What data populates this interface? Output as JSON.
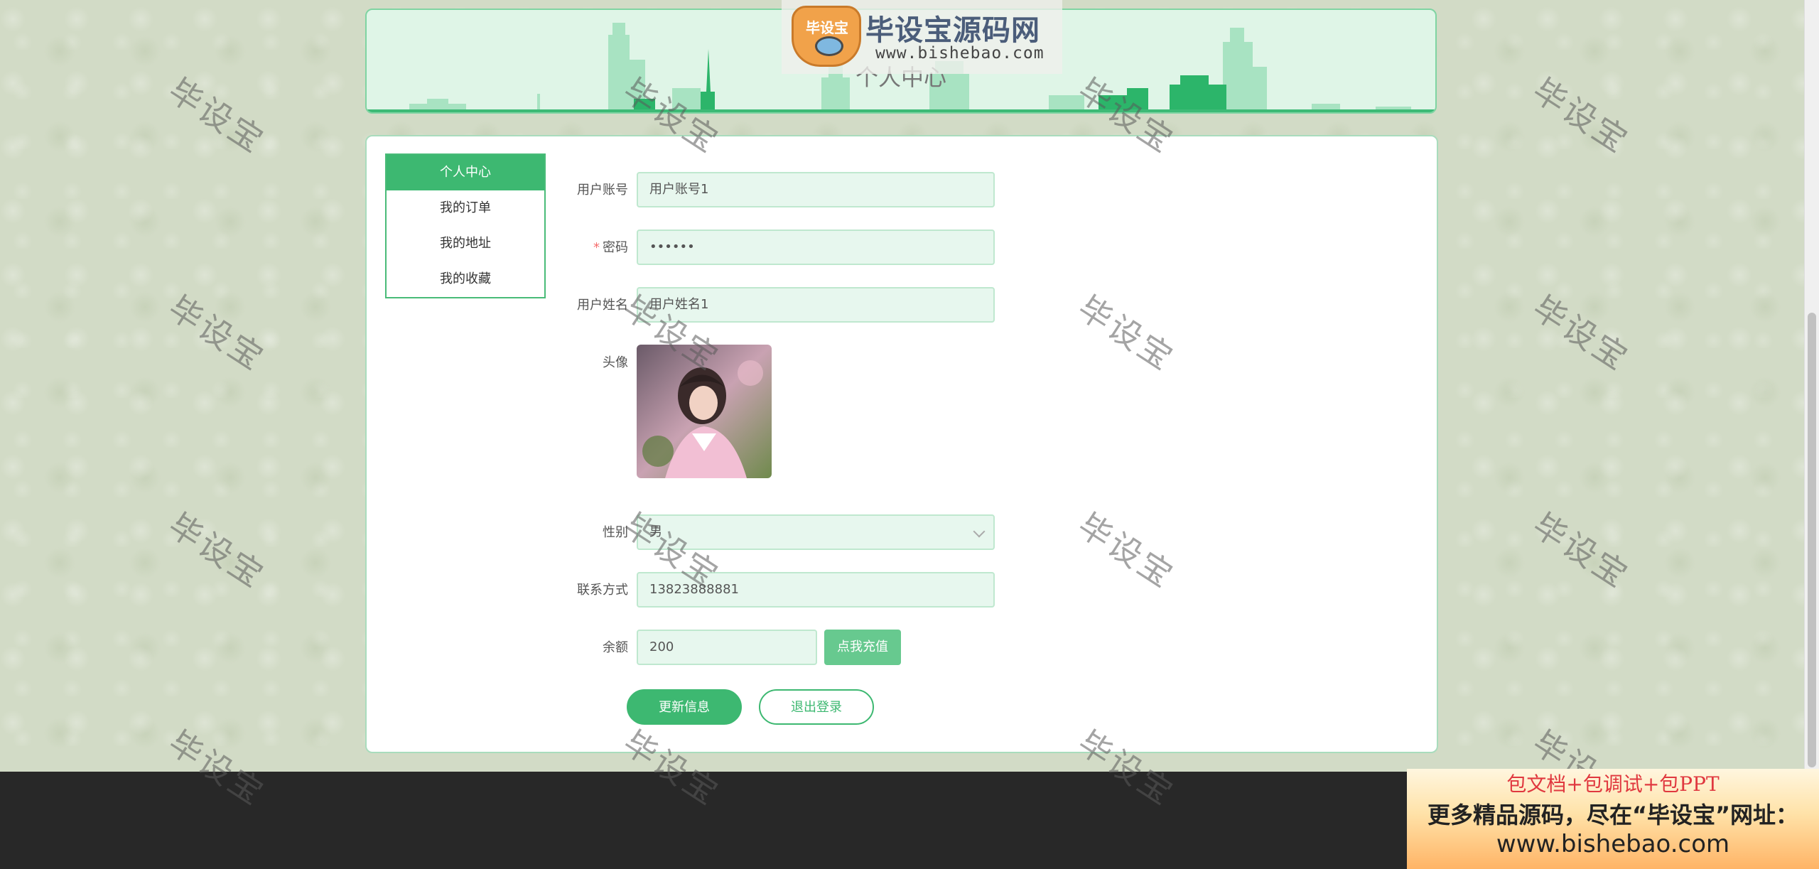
{
  "header": {
    "title": "个人中心",
    "logo_name": "毕设宝源码网",
    "logo_url": "www.bishebao.com",
    "logo_badge": "毕设宝"
  },
  "sidebar": {
    "items": [
      {
        "label": "个人中心",
        "active": true
      },
      {
        "label": "我的订单",
        "active": false
      },
      {
        "label": "我的地址",
        "active": false
      },
      {
        "label": "我的收藏",
        "active": false
      }
    ]
  },
  "form": {
    "username": {
      "label": "用户账号",
      "value": "用户账号1"
    },
    "password": {
      "label": "密码",
      "required_mark": "*",
      "value": "••••••"
    },
    "realname": {
      "label": "用户姓名",
      "value": "用户姓名1"
    },
    "avatar": {
      "label": "头像"
    },
    "gender": {
      "label": "性别",
      "value": "男"
    },
    "phone": {
      "label": "联系方式",
      "value": "13823888881"
    },
    "balance": {
      "label": "余额",
      "value": "200",
      "recharge_label": "点我充值"
    }
  },
  "actions": {
    "update_label": "更新信息",
    "logout_label": "退出登录"
  },
  "watermark": {
    "text": "毕设宝"
  },
  "promo": {
    "line1": "包文档+包调试+包PPT",
    "line2": "更多精品源码，尽在“毕设宝”网址：",
    "line3": "www.bishebao.com"
  },
  "colors": {
    "accent": "#3db871",
    "input_bg": "#e7f7ee",
    "banner_bg": "#dff5e7",
    "page_bg": "#d2dbc6",
    "footer_bg": "#282828"
  }
}
